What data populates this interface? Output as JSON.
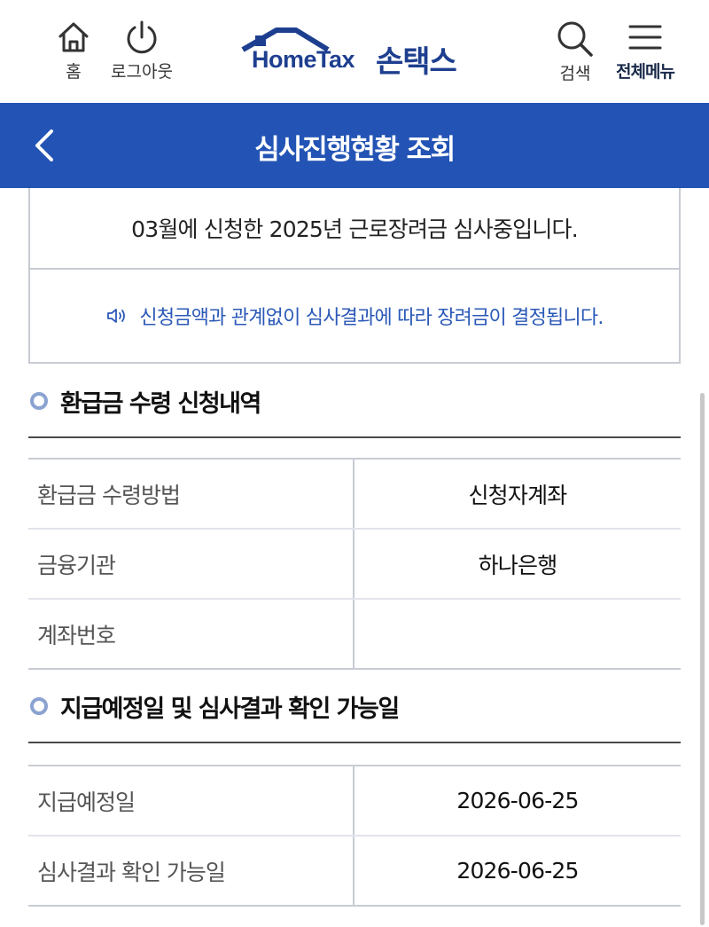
{
  "header": {
    "home_label": "홈",
    "logout_label": "로그아웃",
    "logo_en": "HomeTax",
    "logo_ko": "손택스",
    "search_label": "검색",
    "menu_label": "전체메뉴",
    "brand_color": "#1e3f8f"
  },
  "title_bar": {
    "title": "심사진행현황 조회",
    "bg_color": "#2354b5"
  },
  "status": {
    "main_text": "03월에 신청한 2025년 근로장려금 심사중입니다.",
    "note_text": "신청금액과 관계없이 심사결과에 따라 장려금이 결정됩니다."
  },
  "refund_section": {
    "heading": "환급금 수령 신청내역",
    "rows": [
      {
        "label": "환급금 수령방법",
        "value": "신청자계좌"
      },
      {
        "label": "금융기관",
        "value": "하나은행"
      },
      {
        "label": "계좌번호",
        "value": ""
      }
    ]
  },
  "schedule_section": {
    "heading": "지급예정일 및 심사결과 확인 가능일",
    "rows": [
      {
        "label": "지급예정일",
        "value": "2026-06-25"
      },
      {
        "label": "심사결과 확인 가능일",
        "value": "2026-06-25"
      }
    ]
  }
}
